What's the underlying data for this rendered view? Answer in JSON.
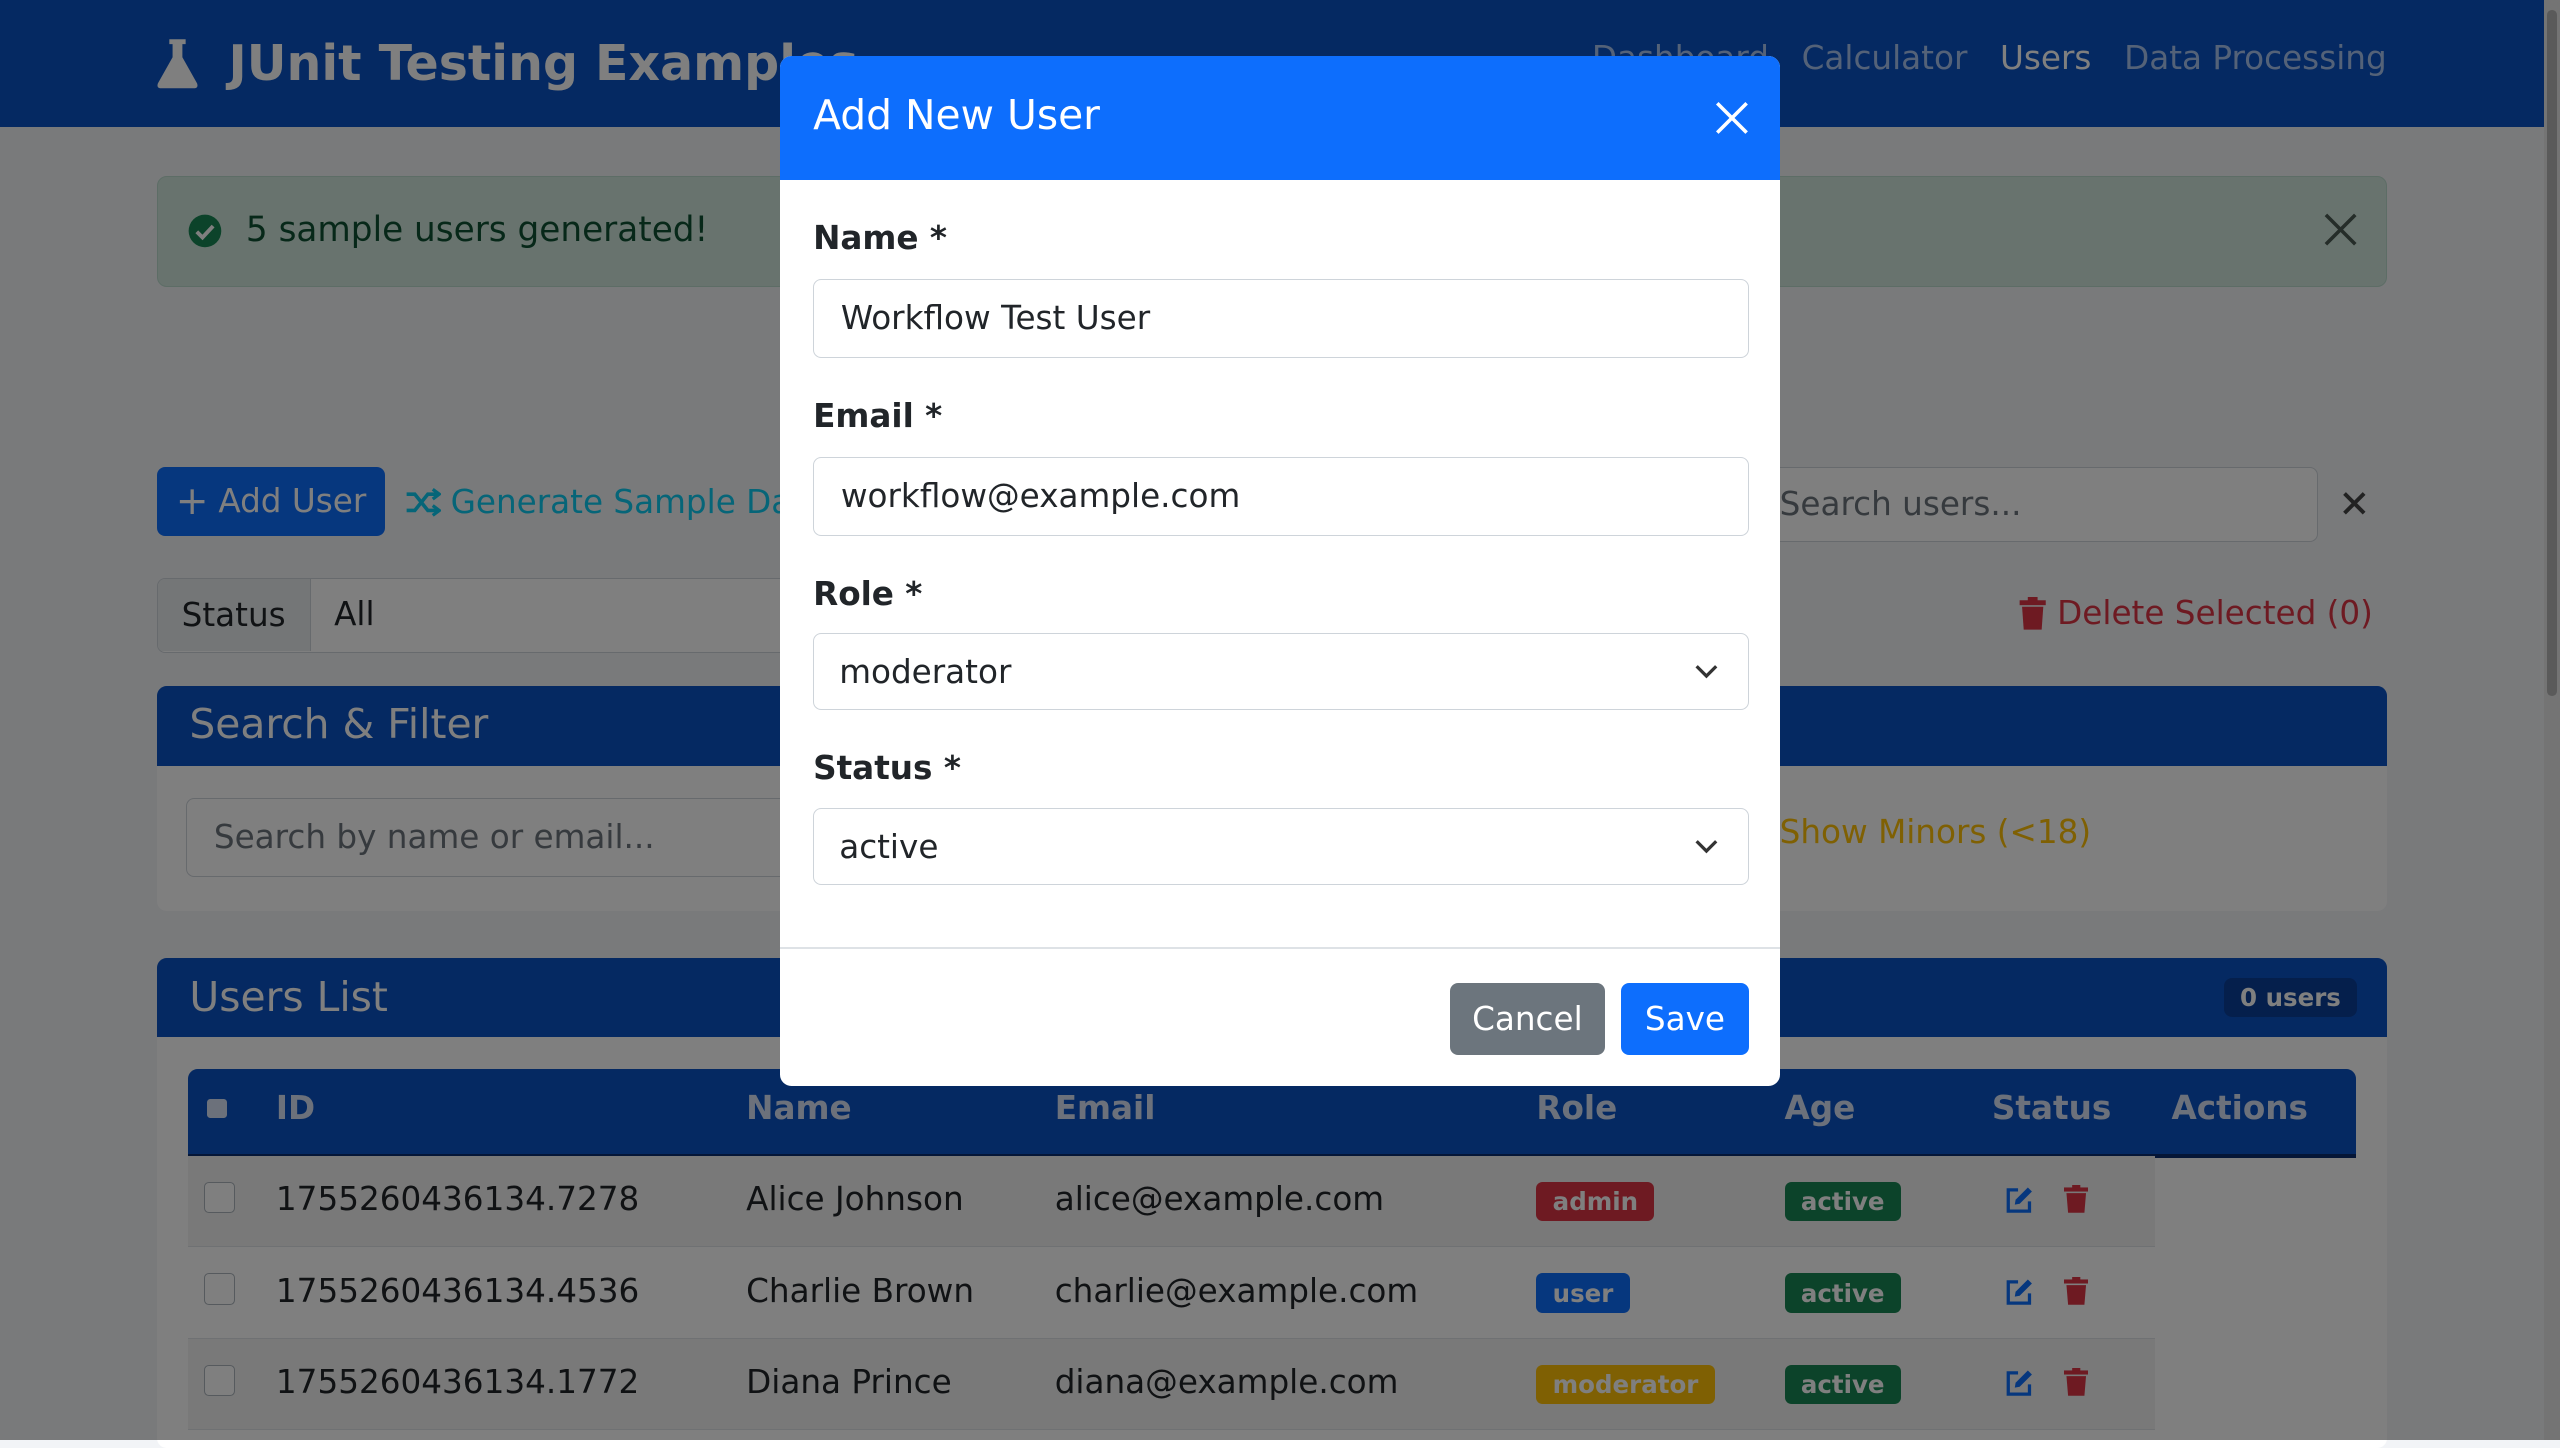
{
  "navbar": {
    "brand": "JUnit Testing Examples",
    "links": [
      "Dashboard",
      "Calculator",
      "Users",
      "Data Processing"
    ]
  },
  "alert": {
    "message": "5 sample users generated!"
  },
  "toolbar": {
    "add_user": "Add User",
    "generate": "Generate Sample Data",
    "search_placeholder": "Search users...",
    "status_label": "Status",
    "status_value": "All",
    "delete_selected": "Delete Selected (0)"
  },
  "search_filter": {
    "title": "Search & Filter",
    "placeholder": "Search by name or email...",
    "minors": "Show Minors (<18)"
  },
  "users_list": {
    "title": "Users List",
    "count": "0 users",
    "columns": [
      "ID",
      "Name",
      "Email",
      "Role",
      "Age",
      "Status",
      "Actions"
    ],
    "rows": [
      {
        "id": "1755260436134.7278",
        "name": "Alice Johnson",
        "email": "alice@example.com",
        "role": "admin",
        "status": "active"
      },
      {
        "id": "1755260436134.4536",
        "name": "Charlie Brown",
        "email": "charlie@example.com",
        "role": "user",
        "status": "active"
      },
      {
        "id": "1755260436134.1772",
        "name": "Diana Prince",
        "email": "diana@example.com",
        "role": "moderator",
        "status": "active"
      }
    ]
  },
  "modal": {
    "title": "Add New User",
    "name_label": "Name *",
    "name_value": "Workflow Test User",
    "email_label": "Email *",
    "email_value": "workflow@example.com",
    "role_label": "Role *",
    "role_value": "moderator",
    "status_label": "Status *",
    "status_value": "active",
    "cancel": "Cancel",
    "save": "Save"
  },
  "colors": {
    "primary": "#0d6efd",
    "navbar": "#0b53c4",
    "admin": "#dc3545",
    "user": "#0d6efd",
    "moderator": "#ffc107",
    "active": "#198754"
  }
}
